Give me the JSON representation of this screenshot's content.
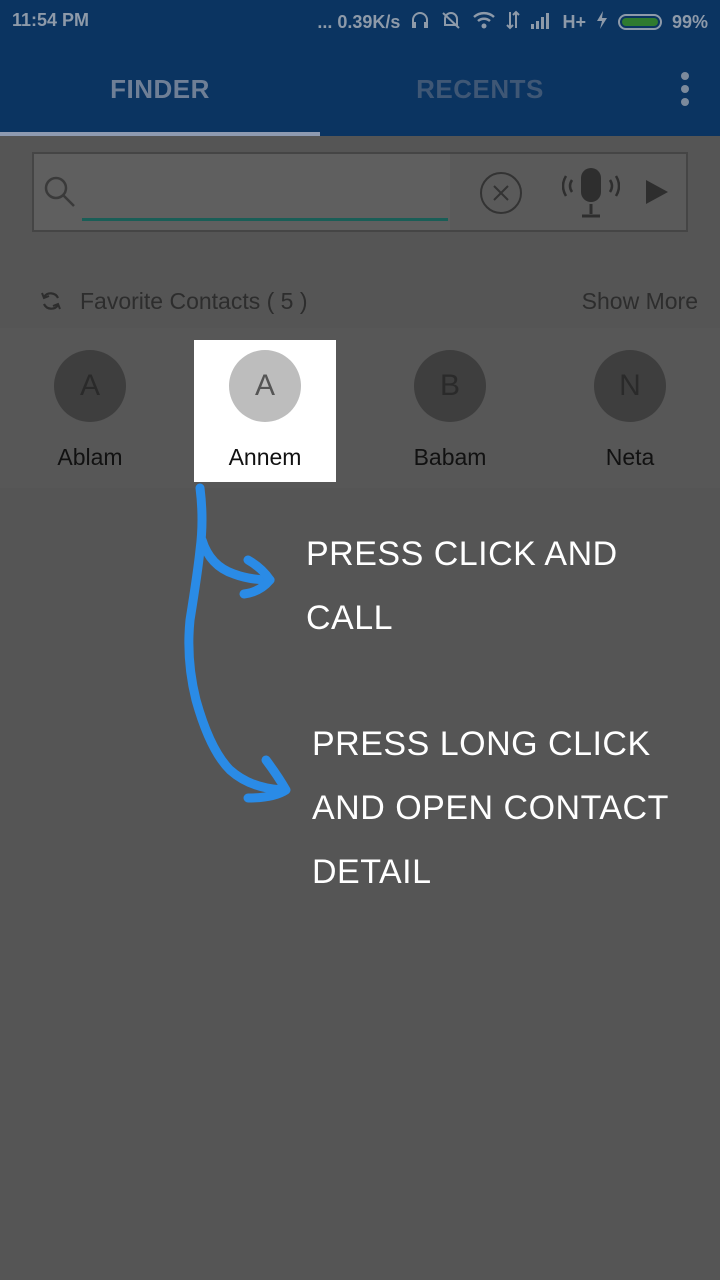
{
  "status_bar": {
    "time": "11:54 PM",
    "network_speed": "... 0.39K/s",
    "network_type": "H+",
    "battery_percent": "99%",
    "battery_level": 0.99,
    "icons": [
      "headset-icon",
      "mute-icon",
      "wifi-icon",
      "data-arrows-icon",
      "signal-icon",
      "charging-icon",
      "battery-icon"
    ]
  },
  "tabs": [
    {
      "label": "FINDER",
      "selected": true
    },
    {
      "label": "RECENTS",
      "selected": false
    }
  ],
  "search": {
    "value": "",
    "placeholder": ""
  },
  "favorites": {
    "title": "Favorite Contacts ( 5 )",
    "show_more": "Show More",
    "contacts": [
      {
        "initial": "A",
        "name": "Ablam"
      },
      {
        "initial": "A",
        "name": "Annem"
      },
      {
        "initial": "B",
        "name": "Babam"
      },
      {
        "initial": "N",
        "name": "Neta"
      }
    ]
  },
  "tutorial": {
    "press_click_line1": "PRESS CLICK AND",
    "press_click_line2": "CALL",
    "long_click_line1": "PRESS LONG CLICK",
    "long_click_line2": "AND OPEN CONTACT",
    "long_click_line3": "DETAIL"
  },
  "colors": {
    "app_bar": "#0b3461",
    "overlay": "#555555",
    "arrow": "#2a8be6",
    "highlight": "#ffffff"
  }
}
